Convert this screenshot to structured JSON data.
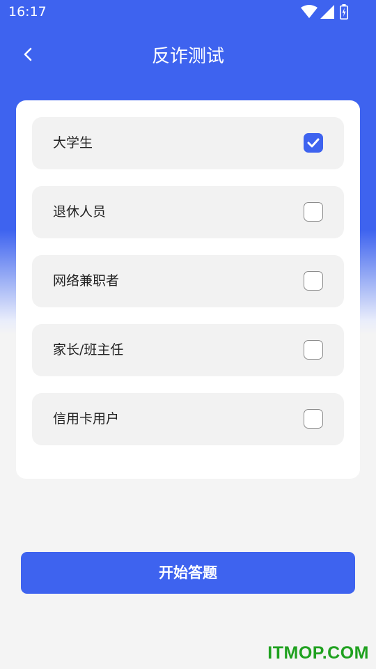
{
  "status_bar": {
    "time": "16:17",
    "icons": [
      "wifi-icon",
      "cellular-signal-icon",
      "battery-charging-icon"
    ]
  },
  "header": {
    "back_icon": "chevron-left-icon",
    "title": "反诈测试"
  },
  "options": [
    {
      "label": "大学生",
      "checked": true
    },
    {
      "label": "退休人员",
      "checked": false
    },
    {
      "label": "网络兼职者",
      "checked": false
    },
    {
      "label": "家长/班主任",
      "checked": false
    },
    {
      "label": "信用卡用户",
      "checked": false
    }
  ],
  "start_button": {
    "label": "开始答题"
  },
  "watermark": {
    "text": "ITMOP.COM"
  },
  "colors": {
    "accent": "#3E63EF",
    "option_bg": "#F2F2F2",
    "page_bg": "#F4F4F4",
    "watermark": "#1FA11F"
  }
}
